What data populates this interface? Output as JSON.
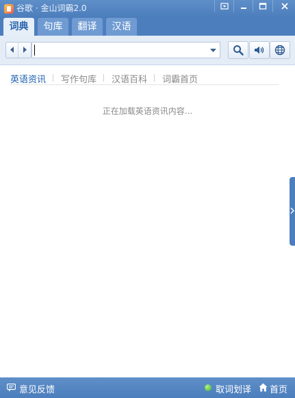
{
  "window": {
    "title": "谷歌 · 金山词霸2.0",
    "colors": {
      "primary": "#4c7ebd",
      "active_tab_bg": "#e6eef8",
      "active_link": "#1b5fb0"
    }
  },
  "tabs": [
    {
      "label": "词典",
      "active": true
    },
    {
      "label": "句库",
      "active": false
    },
    {
      "label": "翻译",
      "active": false
    },
    {
      "label": "汉语",
      "active": false
    }
  ],
  "search": {
    "value": "",
    "placeholder": ""
  },
  "subnav": [
    {
      "label": "英语资讯",
      "active": true
    },
    {
      "label": "写作句库",
      "active": false
    },
    {
      "label": "汉语百科",
      "active": false
    },
    {
      "label": "词霸首页",
      "active": false
    }
  ],
  "content": {
    "loading_text": "正在加载英语资讯内容..."
  },
  "statusbar": {
    "feedback_label": "意见反馈",
    "quword_label": "取词划译",
    "home_label": "首页"
  }
}
